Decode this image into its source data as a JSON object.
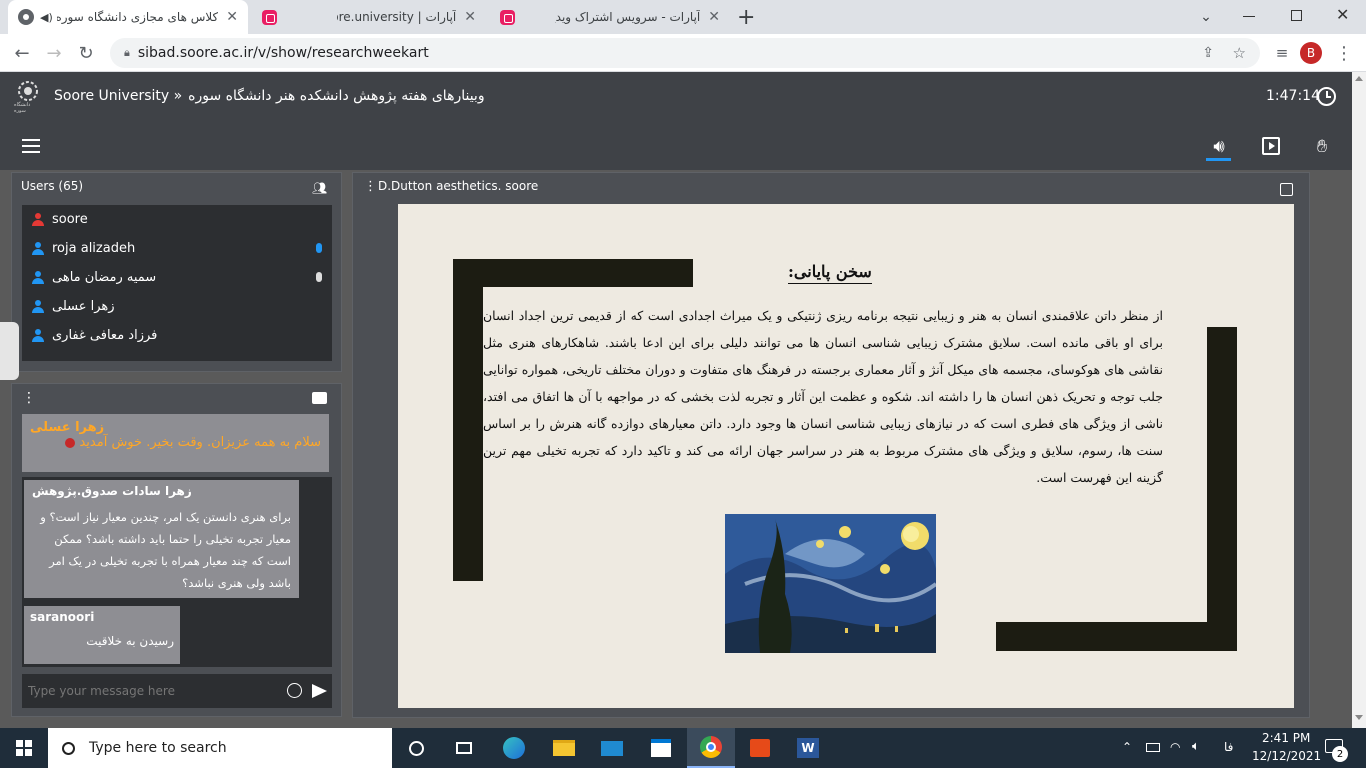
{
  "browser": {
    "tabs": [
      {
        "title": "کلاس های مجازی دانشگاه سوره"
      },
      {
        "title": "آپارات | soore.university"
      },
      {
        "title": "آپارات - سرویس اشتراک ویدیو"
      }
    ],
    "new_tab_label": "+",
    "url": "sibad.soore.ac.ir/v/show/researchweekart",
    "profile_initial": "B"
  },
  "app": {
    "brand": "Soore University »",
    "room_title": "وبینارهای هفته پژوهش دانشکده هنر دانشگاه سوره",
    "timer": "1:47:14",
    "logo_text": "دانشگاه سوره"
  },
  "users": {
    "header": "Users (65)",
    "list": [
      {
        "name": "soore",
        "color": "#e53935",
        "mic": false
      },
      {
        "name": "roja alizadeh",
        "color": "#2196f3",
        "mic": true
      },
      {
        "name": "سمیه رمضان ماهی",
        "color": "#2196f3",
        "mic": true
      },
      {
        "name": "زهرا عسلی",
        "color": "#2196f3",
        "mic": false
      },
      {
        "name": "فرزاد معافی غفاری",
        "color": "#2196f3",
        "mic": false
      }
    ]
  },
  "chat": {
    "pinned_author": "زهرا عسلی",
    "pinned_text": "سلام به همه عزیزان. وقت بخیر. خوش آمدید",
    "messages": [
      {
        "author": "زهرا سادات صدوق.پژوهش",
        "text": "برای هنری دانستن یک امر، چندین معیار نیاز است؟ و معیار تجربه تخیلی را حتما باید داشته باشد؟ ممکن است که چند معیار همراه با تجربه تخیلی در یک امر باشد ولی هنری نباشد؟"
      },
      {
        "author": "saranoori",
        "text": "رسیدن به خلاقیت"
      }
    ],
    "input_placeholder": "Type your message here"
  },
  "presentation": {
    "title": "D.Dutton aesthetics. soore",
    "slide_heading": "سخن پایانی:",
    "slide_body": "از منظر داتن علاقمندی انسان به هنر و زیبایی نتیجه برنامه ریزی ژنتیکی و یک میراث اجدادی است که از قدیمی ترین اجداد انسان برای او باقی مانده است. سلایق مشترک زیبایی شناسی انسان ها می توانند دلیلی برای این ادعا باشند. شاهکارهای هنری مثل نقاشی های هوکوسای، مجسمه های میکل آنژ و آثار معماری برجسته در فرهنگ های متفاوت و دوران مختلف تاریخی، همواره توانایی جلب توجه و تحریک ذهن انسان ها را داشته اند. شکوه و عظمت این آثار و تجربه لذت بخشی که در مواجهه با آن ها اتفاق می افتد، ناشی از ویژگی های فطری است که در نیازهای زیبایی شناسی انسان ها وجود دارد. داتن معیارهای دوازده گانه هنرش را بر اساس سنت ها، رسوم، سلایق و ویژگی های مشترک مربوط به هنر در سراسر جهان ارائه می کند و تاکید دارد که تجربه تخیلی مهم ترین گزینه این فهرست است."
  },
  "taskbar": {
    "search_placeholder": "Type here to search",
    "lang": "فا",
    "time": "2:41 PM",
    "date": "12/12/2021",
    "notif_count": "2"
  }
}
